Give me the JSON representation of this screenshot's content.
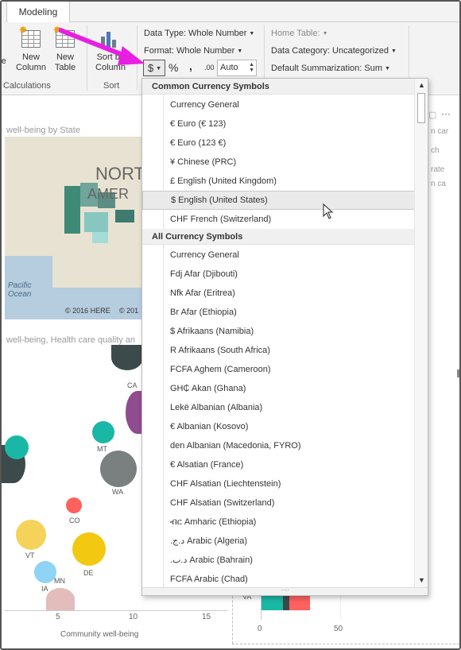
{
  "ribbon": {
    "tab": "Modeling",
    "buttons": {
      "partial_left": "re",
      "new_column": "New\nColumn",
      "new_table": "New\nTable",
      "sort_by_column": "Sort by\nColumn"
    },
    "groups": {
      "calculations": "Calculations",
      "sort": "Sort"
    },
    "data_type": "Data Type: Whole Number",
    "format": "Format: Whole Number",
    "currency_symbol": "$",
    "percent_symbol": "%",
    "comma_symbol": ",",
    "decimal_symbol": ".00",
    "decimal_places": "Auto",
    "home_table": "Home Table:",
    "data_category": "Data Category: Uncategorized",
    "default_summarization": "Default Summarization: Sum"
  },
  "canvas": {
    "map_title": "well-being by State",
    "map_label_north": "NORT",
    "map_label_america": "AMER",
    "map_label_pacific": "Pacific\nOcean",
    "map_copyright_1": "© 2016 HERE",
    "map_copyright_2": "© 201",
    "scatter_title": "well-being, Health care quality an",
    "scatter_xlabel": "Community well-being",
    "scatter_xticks": [
      "5",
      "10",
      "15"
    ],
    "bubble_labels": [
      "CA",
      "MT",
      "WA",
      "CO",
      "VT",
      "DE",
      "MN",
      "IA"
    ],
    "right_texts": [
      "n car",
      "ch",
      "rate",
      "n ca"
    ],
    "right_axis_label": "VA",
    "right_axis_ticks": [
      "0",
      "50"
    ]
  },
  "dropdown": {
    "sections": [
      {
        "header": "Common Currency Symbols",
        "items": [
          "Currency General",
          "€ Euro (€ 123)",
          "€ Euro (123 €)",
          "¥ Chinese (PRC)",
          "£ English (United Kingdom)",
          "$ English (United States)",
          "CHF French (Switzerland)"
        ]
      },
      {
        "header": "All Currency Symbols",
        "items": [
          "Currency General",
          "Fdj Afar (Djibouti)",
          "Nfk Afar (Eritrea)",
          "Br Afar (Ethiopia)",
          "$ Afrikaans (Namibia)",
          "R Afrikaans (South Africa)",
          "FCFA Aghem (Cameroon)",
          "GH₵ Akan (Ghana)",
          "Lekë Albanian (Albania)",
          "€ Albanian (Kosovo)",
          "den Albanian (Macedonia, FYRO)",
          "€ Alsatian (France)",
          "CHF Alsatian (Liechtenstein)",
          "CHF Alsatian (Switzerland)",
          "ብር Amharic (Ethiopia)",
          "د.ج.‏ Arabic (Algeria)",
          "د.ب.‏ Arabic (Bahrain)",
          "FCFA Arabic (Chad)"
        ]
      }
    ],
    "hovered_item": "$ English (United States)"
  },
  "colors": {
    "arrow": "#e81ee3",
    "hover_bg": "#eaeaea",
    "teal": "#1ab7a6",
    "dark_gray": "#3d4a4c",
    "purple": "#8f4c8f",
    "yellow": "#f2c811",
    "red": "#fd625e"
  }
}
